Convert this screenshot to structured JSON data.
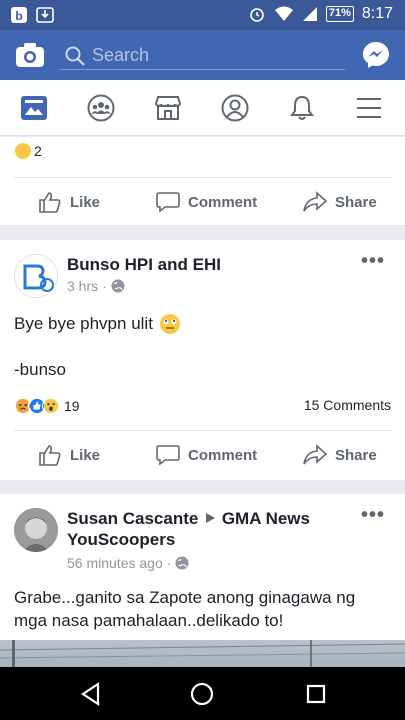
{
  "status_bar": {
    "battery": "71%",
    "time": "8:17"
  },
  "top_bar": {
    "search_placeholder": "Search"
  },
  "nav": [
    {
      "name": "news-feed-icon"
    },
    {
      "name": "groups-icon"
    },
    {
      "name": "marketplace-icon"
    },
    {
      "name": "profile-icon"
    },
    {
      "name": "notifications-icon"
    },
    {
      "name": "menu-icon"
    }
  ],
  "actions": {
    "like": "Like",
    "comment": "Comment",
    "share": "Share"
  },
  "post0": {
    "reaction_count": "2"
  },
  "post1": {
    "author": "Bunso HPI and EHI",
    "time": "3 hrs",
    "text_line1": "Bye bye phvpn ulit",
    "text_line2": "-bunso",
    "reaction_count": "19",
    "comments": "15 Comments"
  },
  "post2": {
    "author_line1": "Susan Cascante",
    "author_target": "GMA News",
    "author_line2": "YouScoopers",
    "time": "56 minutes ago",
    "text_line1": "Grabe...ganito sa Zapote anong ginagawa ng",
    "text_line2": "mga nasa pamahalaan..delikado to!"
  },
  "colors": {
    "brand": "#4267b2",
    "status": "#3b5998",
    "active_nav": "#4267b2",
    "like_blue": "#1877f2",
    "haha_yellow": "#f7c846",
    "angry_orange": "#f0a040"
  }
}
